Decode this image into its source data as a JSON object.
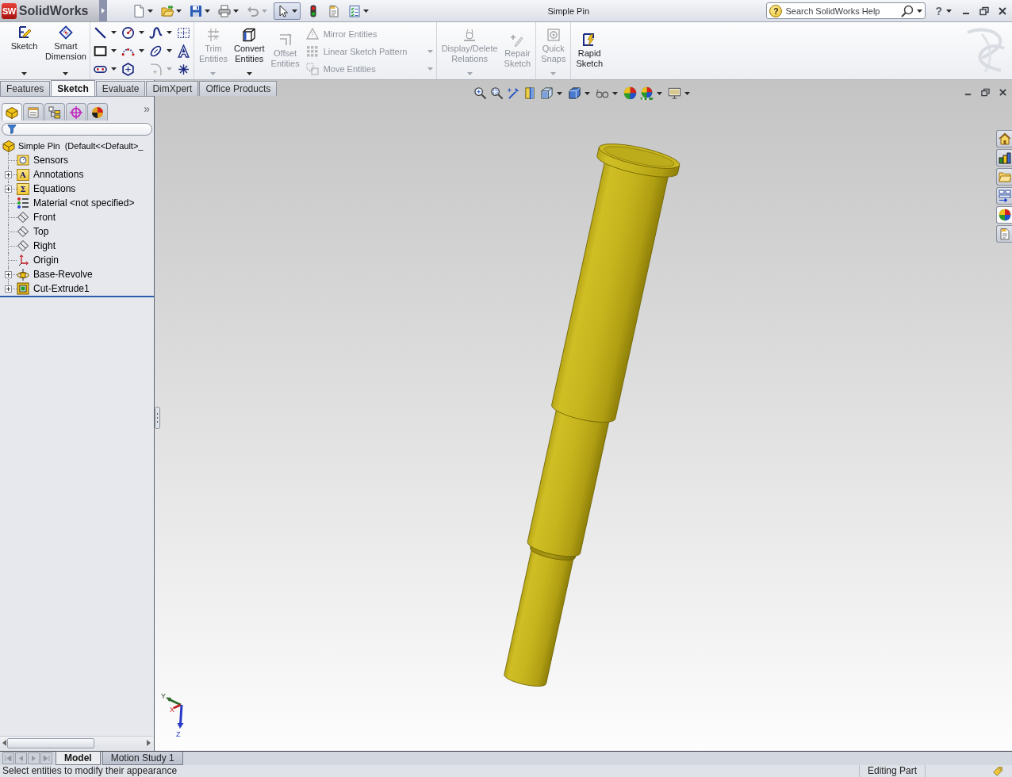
{
  "title_bar": {
    "logo_badge": "SW",
    "logo": "SolidWorks",
    "title": "Simple Pin",
    "search": {
      "badge": "?",
      "placeholder": "Search SolidWorks Help"
    },
    "help_menu": "?"
  },
  "quick_access": [
    {
      "kind": "new",
      "disabled": false,
      "pressed": false,
      "dropdown": true
    },
    {
      "kind": "open",
      "disabled": false,
      "pressed": false,
      "dropdown": true
    },
    {
      "kind": "save",
      "disabled": false,
      "pressed": false,
      "dropdown": true
    },
    {
      "kind": "print",
      "disabled": false,
      "pressed": false,
      "dropdown": true
    },
    {
      "kind": "undo",
      "disabled": true,
      "pressed": false,
      "dropdown": true
    },
    {
      "kind": "select",
      "disabled": false,
      "pressed": true,
      "dropdown": true
    },
    {
      "kind": "rebuild",
      "disabled": false,
      "pressed": false,
      "dropdown": false
    },
    {
      "kind": "properties",
      "disabled": false,
      "pressed": false,
      "dropdown": false
    },
    {
      "kind": "options",
      "disabled": false,
      "pressed": false,
      "dropdown": true
    }
  ],
  "ribbon": {
    "groups": [
      {
        "kind": "large",
        "items": [
          {
            "kind": "sketch",
            "label": "Sketch",
            "disabled": false,
            "dropdown": true
          },
          {
            "kind": "dimension",
            "label": "Smart Dimension",
            "disabled": false,
            "dropdown": true
          }
        ]
      },
      {
        "kind": "tools",
        "items": [
          {
            "kind": "line",
            "disabled": false,
            "dropdown": true
          },
          {
            "kind": "circle",
            "disabled": false,
            "dropdown": true
          },
          {
            "kind": "spline",
            "disabled": false,
            "dropdown": true
          },
          {
            "kind": "grid",
            "disabled": false,
            "dropdown": false
          },
          {
            "kind": "rectangle",
            "disabled": false,
            "dropdown": true
          },
          {
            "kind": "arc",
            "disabled": false,
            "dropdown": true
          },
          {
            "kind": "ellipse",
            "disabled": false,
            "dropdown": true
          },
          {
            "kind": "text",
            "disabled": false,
            "dropdown": false
          },
          {
            "kind": "slot",
            "disabled": false,
            "dropdown": true
          },
          {
            "kind": "polygon",
            "disabled": false,
            "dropdown": false
          },
          {
            "kind": "fillet",
            "disabled": true,
            "dropdown": true
          },
          {
            "kind": "point",
            "disabled": false,
            "dropdown": false
          }
        ]
      },
      {
        "kind": "large",
        "items": [
          {
            "kind": "trim",
            "label": "Trim Entities",
            "disabled": true,
            "dropdown": true
          },
          {
            "kind": "convert",
            "label": "Convert Entities",
            "disabled": false,
            "dropdown": true
          },
          {
            "kind": "offset",
            "label": "Offset Entities",
            "disabled": true,
            "dropdown": false
          }
        ]
      },
      {
        "kind": "stack",
        "items": [
          {
            "kind": "mirror",
            "label": "Mirror Entities",
            "disabled": true,
            "dropdown": false
          },
          {
            "kind": "pattern",
            "label": "Linear Sketch Pattern",
            "disabled": true,
            "dropdown": true
          },
          {
            "kind": "move",
            "label": "Move Entities",
            "disabled": true,
            "dropdown": true
          }
        ]
      },
      {
        "kind": "large",
        "items": [
          {
            "kind": "relations",
            "label": "Display/Delete Relations",
            "disabled": true,
            "dropdown": true
          },
          {
            "kind": "repair",
            "label": "Repair Sketch",
            "disabled": true,
            "dropdown": false
          }
        ]
      },
      {
        "kind": "large",
        "items": [
          {
            "kind": "snaps",
            "label": "Quick Snaps",
            "disabled": true,
            "dropdown": true
          }
        ]
      },
      {
        "kind": "large",
        "items": [
          {
            "kind": "rapid",
            "label": "Rapid Sketch",
            "disabled": false,
            "dropdown": false
          }
        ]
      }
    ]
  },
  "command_tabs": [
    {
      "label": "Features",
      "selected": false
    },
    {
      "label": "Sketch",
      "selected": true
    },
    {
      "label": "Evaluate",
      "selected": false
    },
    {
      "label": "DimXpert",
      "selected": false
    },
    {
      "label": "Office Products",
      "selected": false
    }
  ],
  "feature_manager": {
    "tabs": [
      {
        "kind": "tree",
        "selected": true
      },
      {
        "kind": "properties",
        "selected": false
      },
      {
        "kind": "configurations",
        "selected": false
      },
      {
        "kind": "dimxpert",
        "selected": false
      },
      {
        "kind": "display",
        "selected": false
      }
    ],
    "more": "»",
    "tree": {
      "kind": "part",
      "label": "Simple Pin  (Default<<Default>_",
      "children": [
        {
          "kind": "sensors",
          "label": "Sensors",
          "expander": false
        },
        {
          "kind": "annotations",
          "glyph": "A",
          "label": "Annotations",
          "expander": true
        },
        {
          "kind": "equations",
          "glyph": "Σ",
          "label": "Equations",
          "expander": true
        },
        {
          "kind": "material",
          "label": "Material <not specified>",
          "expander": false
        },
        {
          "kind": "plane",
          "label": "Front",
          "expander": false
        },
        {
          "kind": "plane",
          "label": "Top",
          "expander": false
        },
        {
          "kind": "plane",
          "label": "Right",
          "expander": false
        },
        {
          "kind": "origin",
          "label": "Origin",
          "expander": false
        },
        {
          "kind": "revolve",
          "label": "Base-Revolve",
          "expander": true
        },
        {
          "kind": "extrude",
          "label": "Cut-Extrude1",
          "expander": true
        }
      ]
    }
  },
  "viewport": {
    "task_pane": [
      {
        "kind": "home",
        "selected": false
      },
      {
        "kind": "library",
        "selected": false
      },
      {
        "kind": "folder",
        "selected": false
      },
      {
        "kind": "palette",
        "selected": false
      },
      {
        "kind": "appearances",
        "selected": true
      },
      {
        "kind": "properties",
        "selected": false
      }
    ],
    "triad": {
      "x": "X",
      "y": "Y",
      "z": "Z"
    }
  },
  "bottom_tabs": [
    {
      "label": "Model",
      "selected": true
    },
    {
      "label": "Motion Study 1",
      "selected": false
    }
  ],
  "status_bar": {
    "message": "Select entities to modify their appearance",
    "mode": "Editing Part"
  }
}
